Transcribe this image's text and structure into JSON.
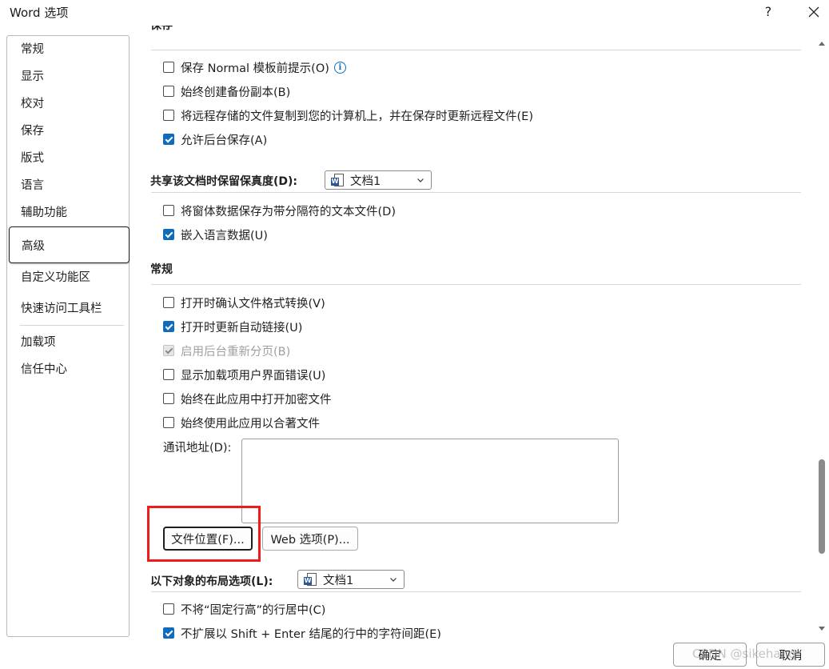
{
  "window": {
    "title": "Word 选项",
    "help_label": "?"
  },
  "sidebar": {
    "items": [
      {
        "label": "常规"
      },
      {
        "label": "显示"
      },
      {
        "label": "校对"
      },
      {
        "label": "保存"
      },
      {
        "label": "版式"
      },
      {
        "label": "语言"
      },
      {
        "label": "辅助功能"
      },
      {
        "label": "高级",
        "selected": true
      },
      {
        "label": "自定义功能区"
      },
      {
        "label": "快速访问工具栏"
      },
      {
        "label": "加载项"
      },
      {
        "label": "信任中心"
      }
    ]
  },
  "save_section": {
    "heading_partial": "保存",
    "options": [
      {
        "label": "保存 Normal 模板前提示(O)",
        "checked": false,
        "has_info_icon": true
      },
      {
        "label": "始终创建备份副本(B)",
        "checked": false
      },
      {
        "label": "将远程存储的文件复制到您的计算机上，并在保存时更新远程文件(E)",
        "checked": false
      },
      {
        "label": "允许后台保存(A)",
        "checked": true
      }
    ]
  },
  "fidelity_section": {
    "heading": "共享该文档时保留保真度(D):",
    "combo_value": "文档1",
    "options": [
      {
        "label": "将窗体数据保存为带分隔符的文本文件(D)",
        "checked": false
      },
      {
        "label": "嵌入语言数据(U)",
        "checked": true
      }
    ]
  },
  "general_section": {
    "heading": "常规",
    "options": [
      {
        "label": "打开时确认文件格式转换(V)",
        "checked": false
      },
      {
        "label": "打开时更新自动链接(U)",
        "checked": true
      },
      {
        "label": "启用后台重新分页(B)",
        "checked": true,
        "disabled": true
      },
      {
        "label": "显示加载项用户界面错误(U)",
        "checked": false
      },
      {
        "label": "始终在此应用中打开加密文件",
        "checked": false
      },
      {
        "label": "始终使用此应用以合著文件",
        "checked": false
      }
    ],
    "address_label": "通讯地址(D):",
    "address_value": "",
    "file_locations_button": "文件位置(F)...",
    "web_options_button": "Web 选项(P)..."
  },
  "layout_section": {
    "heading": "以下对象的布局选项(L):",
    "combo_value": "文档1",
    "options": [
      {
        "label": "不将“固定行高”的行居中(C)",
        "checked": false
      },
      {
        "label": "不扩展以 Shift + Enter 结尾的行中的字符间距(E)",
        "checked": true
      }
    ]
  },
  "footer": {
    "ok_label": "确定",
    "cancel_label": "取消"
  },
  "watermark": "CSDN @sikehang",
  "colors": {
    "accent": "#0f6cbd",
    "highlight": "#ef1c1c"
  }
}
